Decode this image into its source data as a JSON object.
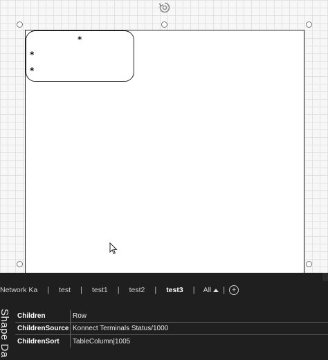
{
  "canvas": {
    "inner_shape_markers": [
      "*",
      "*",
      "*"
    ]
  },
  "tabs": [
    {
      "label": "Network Ka",
      "active": false
    },
    {
      "label": "test",
      "active": false
    },
    {
      "label": "test1",
      "active": false
    },
    {
      "label": "test2",
      "active": false
    },
    {
      "label": "test3",
      "active": true
    }
  ],
  "tab_all_label": "All",
  "add_tab_symbol": "+",
  "side_panel_title": "Shape Da",
  "properties": [
    {
      "key": "Children",
      "value": "Row"
    },
    {
      "key": "ChildrenSource",
      "value": "Konnect Terminals Status/1000"
    },
    {
      "key": "ChildrenSort",
      "value": "TableColumn|1005"
    }
  ],
  "icons": {
    "rotate": "rotate-handle-icon",
    "cursor": "mouse-pointer-icon",
    "add": "plus-circle-icon",
    "dropdown": "triangle-up-icon"
  }
}
